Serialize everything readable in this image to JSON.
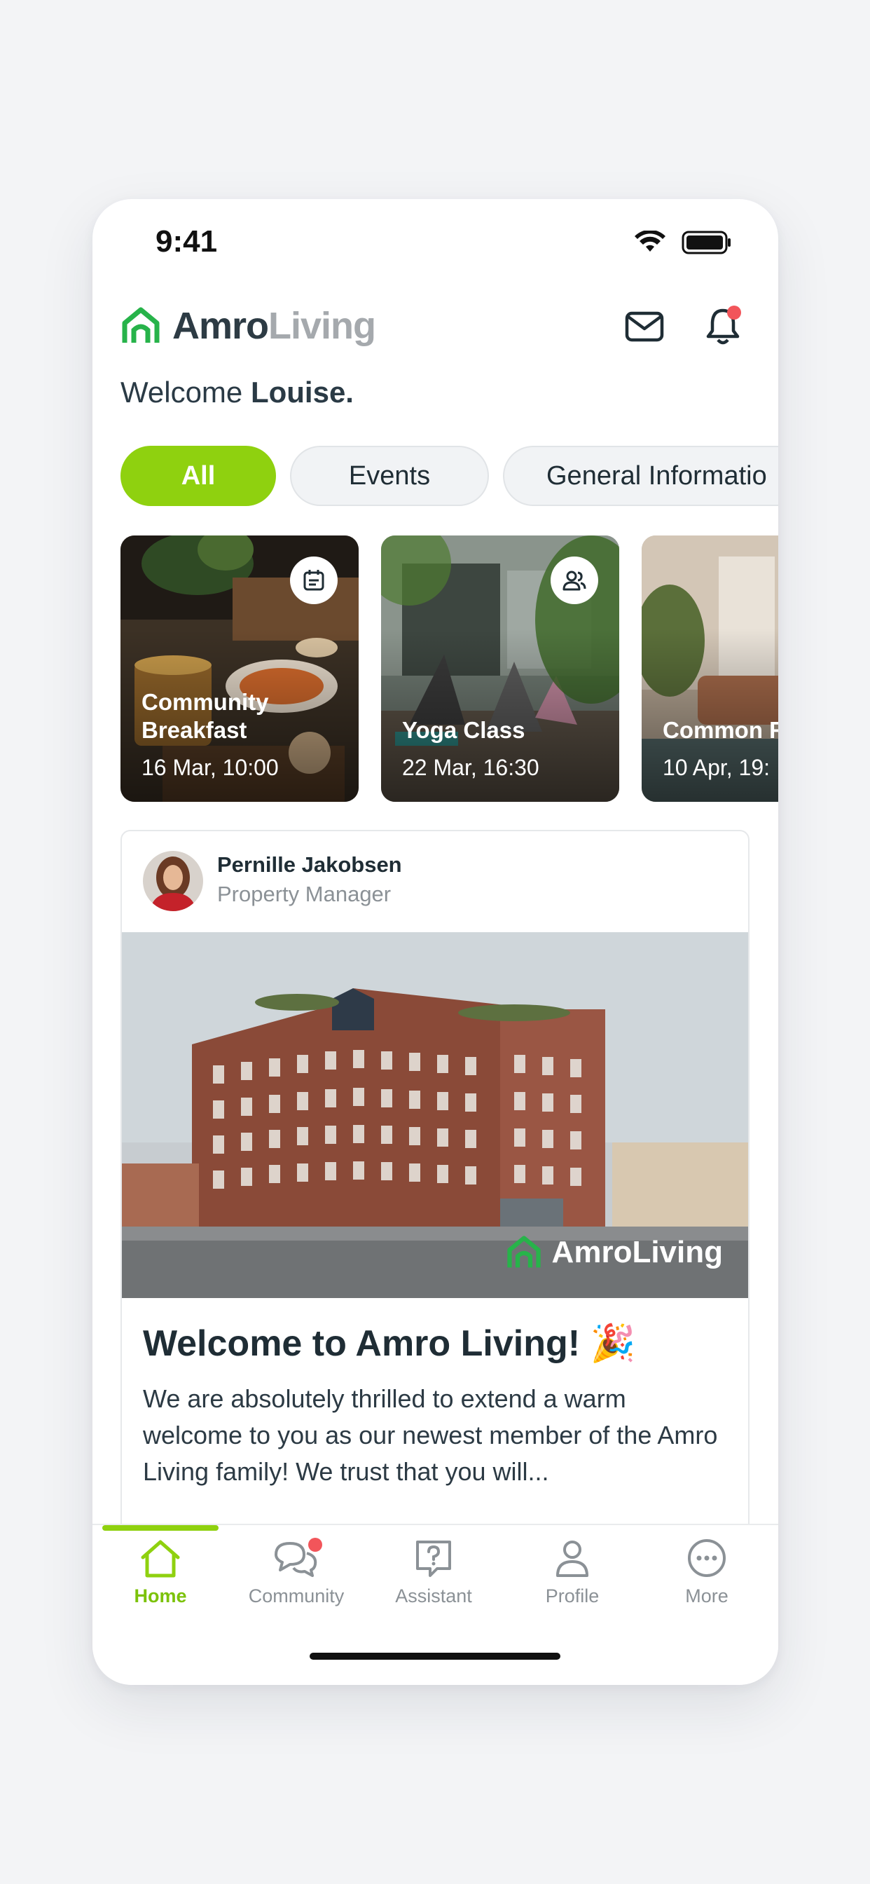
{
  "status_bar": {
    "time": "9:41"
  },
  "header": {
    "logo_primary": "Amro",
    "logo_secondary": "Living",
    "welcome_prefix": "Welcome ",
    "user_name": "Louise."
  },
  "filters": [
    {
      "label": "All",
      "selected": true
    },
    {
      "label": "Events",
      "selected": false
    },
    {
      "label": "General Informatio",
      "selected": false
    }
  ],
  "events": [
    {
      "title": "Community Breakfast",
      "date": "16 Mar, 10:00",
      "icon": "calendar-icon"
    },
    {
      "title": "Yoga Class",
      "date": "22 Mar, 16:30",
      "icon": "group-icon"
    },
    {
      "title": "Common R",
      "date": "10 Apr, 19:",
      "icon": ""
    }
  ],
  "post": {
    "author": "Pernille Jakobsen",
    "role": "Property Manager",
    "image_watermark": "AmroLiving",
    "title": "Welcome to Amro Living! 🎉",
    "body": "We are absolutely thrilled to extend a warm welcome to you as our newest member of the Amro Living family! We trust that you will..."
  },
  "tabs": [
    {
      "label": "Home",
      "icon": "home-icon",
      "active": true
    },
    {
      "label": "Community",
      "icon": "chat-icon",
      "active": false,
      "badge": true
    },
    {
      "label": "Assistant",
      "icon": "question-icon",
      "active": false
    },
    {
      "label": "Profile",
      "icon": "person-icon",
      "active": false
    },
    {
      "label": "More",
      "icon": "more-icon",
      "active": false
    }
  ],
  "colors": {
    "accent": "#8fd10f",
    "brand_green": "#27b34a",
    "notification": "#f2555a",
    "text": "#1f2d35"
  }
}
